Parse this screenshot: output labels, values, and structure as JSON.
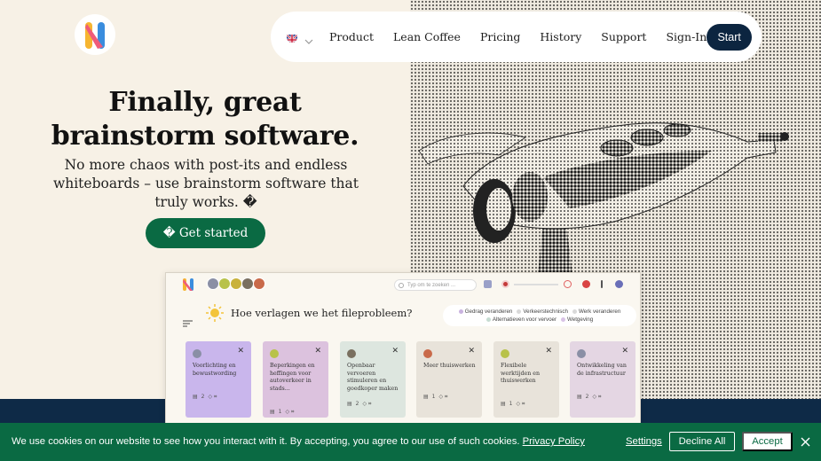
{
  "brand": {
    "logo_icon": "brand-n-logo-icon"
  },
  "nav": {
    "language_icon": "uk-flag-icon",
    "items": [
      "Product",
      "Lean Coffee",
      "Pricing",
      "History",
      "Support",
      "Sign-In"
    ],
    "start_label": "Start"
  },
  "hero": {
    "headline_line1": "Finally, great",
    "headline_line2": "brainstorm software.",
    "subheadline": "No more chaos with post-its and endless whiteboards – use brainstorm software that truly works. �",
    "cta_label": "� Get started",
    "image_icon": "telescope-viewer-illustration"
  },
  "preview": {
    "search_placeholder": "Typ om te zoeken ...",
    "board_title": "Hoe verlagen we het fileprobleem?",
    "legend": [
      {
        "label": "Gedrag veranderen",
        "color": "#c9b3df"
      },
      {
        "label": "Verkeerstechnisch",
        "color": "#d9d9d9"
      },
      {
        "label": "Werk veranderen",
        "color": "#d9d9d9"
      },
      {
        "label": "Alternatieven voor vervoer",
        "color": "#c6dcd2"
      },
      {
        "label": "Wetgeving",
        "color": "#d9c3e6"
      }
    ],
    "cards": [
      {
        "text": "Voorlichting en bewustwording",
        "comments": "2",
        "color": "#c9b6ec"
      },
      {
        "text": "Beperkingen en heffingen voor autoverkeer in stads...",
        "comments": "1",
        "color": "#dcc2de"
      },
      {
        "text": "Openbaar vervoeren stimuleren en goedkoper maken",
        "comments": "2",
        "color": "#dde6df"
      },
      {
        "text": "Meer thuiswerken",
        "comments": "1",
        "color": "#e8e3da"
      },
      {
        "text": "Flexibele werktijden en thuiswerken",
        "comments": "1",
        "color": "#e8e3da"
      },
      {
        "text": "Ontwikkeling van de infrastructuur",
        "comments": "2",
        "color": "#e4d6e3"
      }
    ]
  },
  "cookie": {
    "text": "We use cookies on our website to see how you interact with it. By accepting, you agree to our use of such cookies.",
    "policy_link": "Privacy Policy",
    "settings_label": "Settings",
    "decline_label": "Decline All",
    "accept_label": "Accept"
  },
  "colors": {
    "navy": "#0c2540",
    "green": "#0a6a43",
    "cream": "#f7f1e6"
  }
}
